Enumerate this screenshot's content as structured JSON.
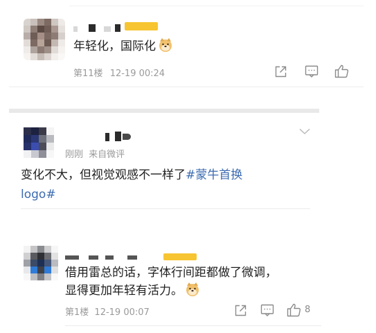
{
  "comments": [
    {
      "id": "c11",
      "text": "年轻化，国际化",
      "floor": "第11楼",
      "date": "12-19 00:24",
      "emoji": "doge-emoji"
    },
    {
      "id": "post",
      "time": "刚刚",
      "source": "来自微评",
      "text": "变化不大，但视觉观感不一样了",
      "topic_line1": "#蒙牛首换",
      "topic_line2": "logo#"
    },
    {
      "id": "c1",
      "line1": "借用雷总的话，字体行间距都做了微调，",
      "line2": "显得更加年轻有活力。",
      "floor": "第1楼",
      "date": "12-19 00:07",
      "like_count": "8",
      "emoji": "doge-emoji"
    }
  ],
  "icons": [
    "share-icon",
    "comment-icon",
    "like-icon",
    "chevron-down-icon"
  ],
  "colors": {
    "topic": "#3c6bb0",
    "meta": "#9a9a9a",
    "divider": "#ececec",
    "censor_yellow": "#f7c531"
  }
}
